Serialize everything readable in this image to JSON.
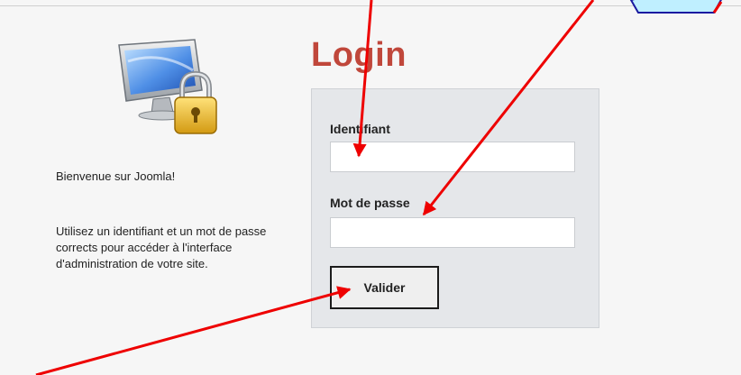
{
  "login": {
    "title": "Login",
    "username_label": "Identifiant",
    "username_value": "",
    "password_label": "Mot de passe",
    "password_value": "",
    "submit_label": "Valider"
  },
  "sidebar": {
    "welcome_text": "Bienvenue sur Joomla!",
    "info_text": "Utilisez un identifiant et un mot de passe corrects pour accéder à l'interface d'administration de votre site."
  },
  "icons": {
    "computer_lock": "computer-lock-icon"
  },
  "colors": {
    "title": "#c0473b",
    "annotation_arrow": "#ee0000",
    "annotation_arrow_outline": "#1a1aa0",
    "panel_background": "#e5e7ea",
    "page_background": "#f6f6f6"
  }
}
